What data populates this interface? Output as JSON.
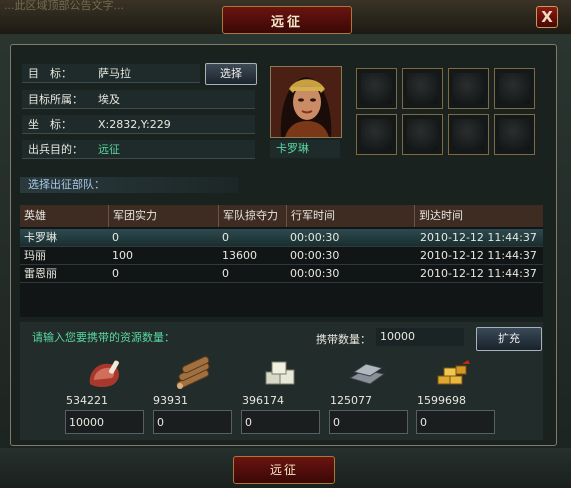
{
  "window": {
    "title": "远征",
    "close_label": "X",
    "bg_notice": "...此区域顶部公告文字..."
  },
  "target": {
    "rows": [
      {
        "label": "目　标：",
        "value": "萨马拉",
        "color": "white"
      },
      {
        "label": "目标所属：",
        "value": "埃及",
        "color": "white"
      },
      {
        "label": "坐　标：",
        "value": "X:2832,Y:229",
        "color": "white"
      },
      {
        "label": "出兵目的：",
        "value": "远征",
        "color": "green"
      }
    ],
    "select_label": "选择"
  },
  "hero": {
    "name": "卡罗琳"
  },
  "troops": {
    "title": "选择出征部队：",
    "columns": [
      "英雄",
      "军团实力",
      "军队掠夺力",
      "行军时间",
      "到达时间"
    ],
    "rows": [
      {
        "hero": "卡罗琳",
        "strength": "0",
        "plunder": "0",
        "march": "00:00:30",
        "arrive": "2010-12-12 11:44:37",
        "selected": true
      },
      {
        "hero": "玛丽",
        "strength": "100",
        "plunder": "13600",
        "march": "00:00:30",
        "arrive": "2010-12-12 11:44:37",
        "selected": false
      },
      {
        "hero": "雷恩丽",
        "strength": "0",
        "plunder": "0",
        "march": "00:00:30",
        "arrive": "2010-12-12 11:44:37",
        "selected": false
      }
    ]
  },
  "resources": {
    "prompt": "请输入您要携带的资源数量：",
    "carry_label": "携带数量：",
    "carry_value": "10000",
    "expand_label": "扩充",
    "items": [
      {
        "icon": "meat-icon",
        "amount": "534221",
        "input": "10000"
      },
      {
        "icon": "wood-icon",
        "amount": "93931",
        "input": "0"
      },
      {
        "icon": "stone-icon",
        "amount": "396174",
        "input": "0"
      },
      {
        "icon": "iron-icon",
        "amount": "125077",
        "input": "0"
      },
      {
        "icon": "gold-icon",
        "amount": "1599698",
        "input": "0"
      }
    ]
  },
  "action": {
    "go_label": "远征"
  }
}
